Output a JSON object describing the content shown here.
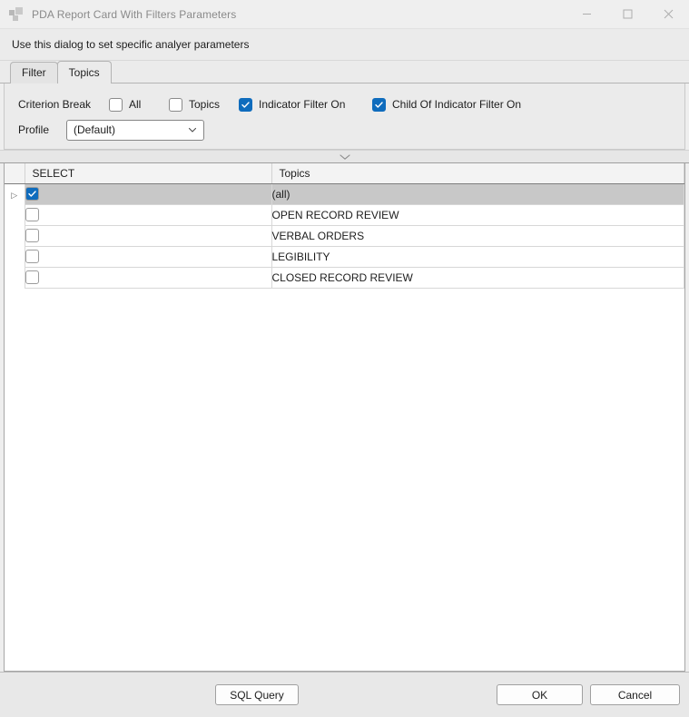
{
  "window": {
    "title": "PDA Report Card With Filters Parameters",
    "app_icon": "app-squares-icon",
    "controls": {
      "minimize": "minimize-icon",
      "maximize": "maximize-icon",
      "close": "close-icon"
    }
  },
  "instruction": {
    "text": "Use this dialog to set specific analyer parameters"
  },
  "tabs": [
    {
      "label": "Filter",
      "active": false
    },
    {
      "label": "Topics",
      "active": true
    }
  ],
  "parameters": {
    "criterion_break_label": "Criterion Break",
    "checkboxes": [
      {
        "label": "All",
        "checked": false
      },
      {
        "label": "Topics",
        "checked": false
      },
      {
        "label": "Indicator Filter On",
        "checked": true
      },
      {
        "label": "Child Of Indicator Filter On",
        "checked": true
      }
    ],
    "profile_label": "Profile",
    "profile_value": "(Default)",
    "profile_options": [
      "(Default)"
    ]
  },
  "splitter": {
    "icon": "chevron-down-icon"
  },
  "grid": {
    "columns": [
      "SELECT",
      "Topics"
    ],
    "rows": [
      {
        "selected": true,
        "checked": true,
        "topic": "(all)"
      },
      {
        "selected": false,
        "checked": false,
        "topic": "OPEN RECORD REVIEW"
      },
      {
        "selected": false,
        "checked": false,
        "topic": "VERBAL ORDERS"
      },
      {
        "selected": false,
        "checked": false,
        "topic": "LEGIBILITY"
      },
      {
        "selected": false,
        "checked": false,
        "topic": "CLOSED RECORD REVIEW"
      }
    ],
    "row_marker": "▷"
  },
  "footer": {
    "sql_query_label": "SQL Query",
    "ok_label": "OK",
    "cancel_label": "Cancel"
  },
  "colors": {
    "accent": "#0f6cbd",
    "selected_row": "#c8c8c8",
    "panel_bg": "#ebebeb",
    "footer_bg": "#e8e8e8"
  }
}
